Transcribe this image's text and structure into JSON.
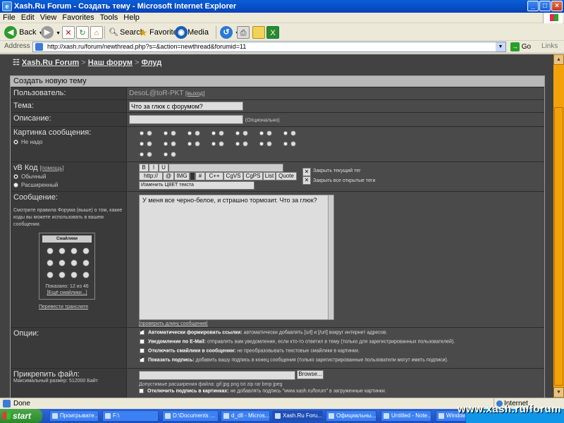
{
  "window": {
    "title": "Xash.Ru Forum - Создать тему - Microsoft Internet Explorer"
  },
  "menu": [
    "File",
    "Edit",
    "View",
    "Favorites",
    "Tools",
    "Help"
  ],
  "toolbar": {
    "back": "Back",
    "search": "Search",
    "favorites": "Favorites",
    "media": "Media"
  },
  "address": {
    "label": "Address",
    "url": "http://xash.ru/forum/newthread.php?s=&action=newthread&forumid=11",
    "go": "Go",
    "links": "Links"
  },
  "breadcrumb": {
    "site": "Xash.Ru Forum",
    "forum": "Наш форум",
    "sub": "Флуд",
    "sep": ">"
  },
  "form": {
    "header": "Создать новую тему",
    "user": {
      "label": "Пользователь:",
      "value": "DesoL@toR-PKT",
      "logout": "[выход]"
    },
    "subject": {
      "label": "Тема:",
      "value": "Что за глюк с форумом?"
    },
    "description": {
      "label": "Описание:",
      "hint": "(Опционально)"
    },
    "icon": {
      "label": "Картинка сообщения:",
      "none": "Не надо"
    },
    "vbcode": {
      "label": "vB Код",
      "help": "[помощь]",
      "mode_normal": "Обычный",
      "mode_extended": "Расширенный",
      "buttons_row1": [
        "B",
        "I",
        "U"
      ],
      "buttons_row2": [
        "http://",
        "@",
        "IMG",
        "#",
        "C++",
        "CgVS",
        "CgPS",
        "List",
        "Quote"
      ],
      "color_select": "Изменить ЦВЕТ текста",
      "close_current": "Закрыть текущий тег",
      "close_all": "Закрыть все открытые теги"
    },
    "message": {
      "label": "Сообщение:",
      "rules": "Смотрите правила Форума (выше) о том, какие коды вы можете использовать в вашем сообщении.",
      "text": "У меня все черно-белое, и страшно тормозит. Что за глюк?",
      "check_length": "[проверить длину сообщения]",
      "smilies_title": "Смайлики",
      "smilies_shown": "Показано: 12 из 46",
      "smilies_more": "[Ещё смайлики...]",
      "translit": "Перевести транслите"
    },
    "options": {
      "label": "Опции:",
      "items": [
        {
          "bold": "Автоматически формировать ссылки:",
          "text": "автоматически добавлять [url] и [/url] вокруг интернет адресов.",
          "checked": true
        },
        {
          "bold": "Уведомление по E-Mail:",
          "text": "отправлять вам уведомление, если кто-то ответил в тему (только для зарегистрированных пользователей).",
          "checked": false
        },
        {
          "bold": "Отключить смайлики в сообщении:",
          "text": "не преобразовывать текстовые смайлики в картинки.",
          "checked": false
        },
        {
          "bold": "Показать подпись:",
          "text": "добавить вашу подпись в конец сообщения (только зарегистрированные пользователи могут иметь подписи).",
          "checked": true
        }
      ]
    },
    "attach": {
      "label": "Прикрепить файл:",
      "max": "Максимальный размер: 512000 Байт",
      "browse": "Browse...",
      "allowed": "Допустимые расширения файла: gif jpg png txt zip rar bmp jpeg",
      "watermark_bold": "Отключить подпись в картинках:",
      "watermark_text": "не добавлять подпись \"www.xash.ru/forum\" в загруженные картинки."
    }
  },
  "status": {
    "left": "Done",
    "zone": "Internet"
  },
  "taskbar": {
    "start": "start",
    "items": [
      "Проигрывате...",
      "F:\\",
      "D:\\Documents ...",
      "d_dll - Micros...",
      "Xash.Ru Foru...",
      "Официальны...",
      "Untitled - Note...",
      "Windows Tas..."
    ]
  },
  "watermark": "www.xash.ru/forum"
}
